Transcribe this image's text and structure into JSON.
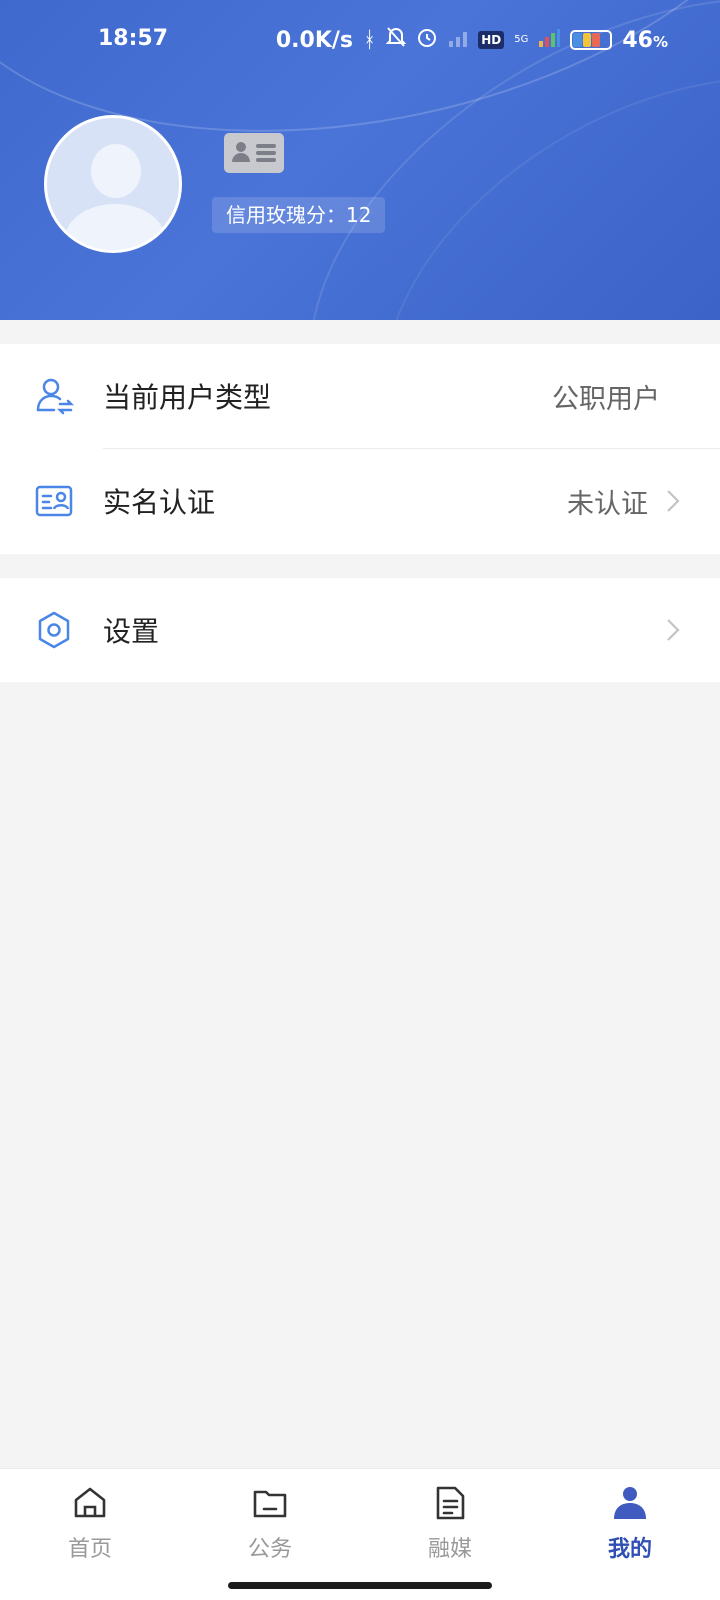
{
  "status_bar": {
    "time": "18:57",
    "net_speed": "0.0K/s",
    "hd": "HD",
    "signal": "5G",
    "battery_percent": "46",
    "battery_suffix": "%"
  },
  "profile": {
    "credit_label": "信用玫瑰分：12"
  },
  "menu": {
    "user_type_label": "当前用户类型",
    "user_type_value": "公职用户",
    "realname_label": "实名认证",
    "realname_value": "未认证",
    "settings_label": "设置"
  },
  "nav": {
    "items": [
      {
        "label": "首页"
      },
      {
        "label": "公务"
      },
      {
        "label": "融媒"
      },
      {
        "label": "我的"
      }
    ],
    "active_index": 3
  },
  "colors": {
    "header_blue": "#4a74d8",
    "accent": "#2f4fb3",
    "icon_blue": "#4a86e8"
  }
}
